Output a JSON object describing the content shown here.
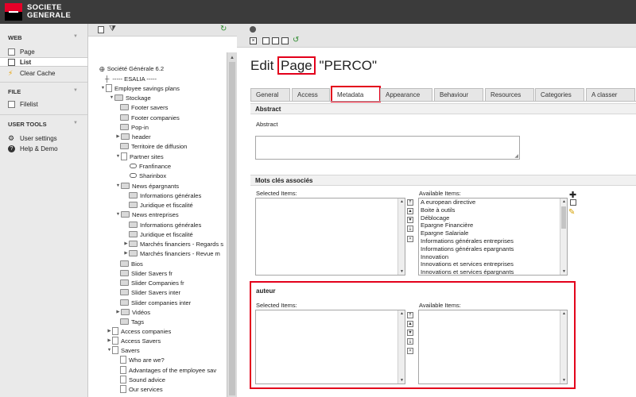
{
  "brand": {
    "line1": "SOCIETE",
    "line2": "GENERALE",
    "red": "#e60028"
  },
  "modmenu": {
    "sections": [
      {
        "title": "WEB",
        "items": [
          "Page",
          "List",
          "Clear Cache"
        ]
      },
      {
        "title": "FILE",
        "items": [
          "Filelist"
        ]
      },
      {
        "title": "USER TOOLS",
        "items": [
          "User settings",
          "Help & Demo"
        ]
      }
    ],
    "active": "List"
  },
  "tree": {
    "root": "Société Générale 6.2",
    "nodes": [
      "----- ESALIA -----",
      "Employee savings plans",
      "Stockage",
      "Footer savers",
      "Footer companies",
      "Pop-in",
      "header",
      "Territoire de diffusion",
      "Partner sites",
      "Franfinance",
      "Sharinbox",
      "News épargnants",
      "Informations générales",
      "Juridique et fiscalité",
      "News entreprises",
      "Informations générales",
      "Juridique et fiscalité",
      "Marchés financiers - Regards s",
      "Marchés financiers - Revue m",
      "Bios",
      "Slider Savers fr",
      "Slider Companies fr",
      "Slider Savers inter",
      "Slider companies inter",
      "Vidéos",
      "Tags",
      "Access companies",
      "Access Savers",
      "Savers",
      "Who are we?",
      "Advantages of the employee sav",
      "Sound advice",
      "Our services"
    ]
  },
  "editor": {
    "title_prefix": "Edit ",
    "title_word": "Page",
    "title_suffix": " \"PERCO\"",
    "tabs": [
      "General",
      "Access",
      "Metadata",
      "Appearance",
      "Behaviour",
      "Resources",
      "Categories",
      "A classer"
    ],
    "active_tab": "Metadata",
    "abstract_section": "Abstract",
    "abstract_label": "Abstract",
    "keywords_section": "Mots clés associés",
    "selected_items": "Selected Items:",
    "available_items": "Available Items:",
    "keywords_available": [
      "A european directive",
      "Boite à outils",
      "Déblocage",
      "Epargne Financière",
      "Epargne Salariale",
      "Informations générales entreprises",
      "Informations générales epargnants",
      "Innovation",
      "Innovations et services entreprises",
      "Innovations et services épargnants"
    ],
    "author_section": "auteur",
    "highlight_color": "#e3001b"
  }
}
